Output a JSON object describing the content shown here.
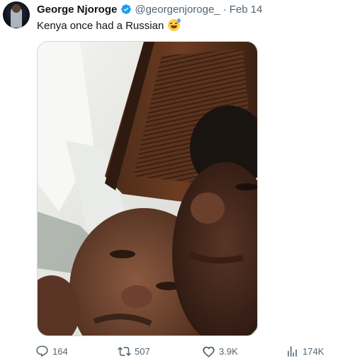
{
  "tweet": {
    "author_name": "George Njoroge",
    "author_handle": "@georgenjoroge_",
    "separator": "·",
    "date": "Feb 14",
    "text": "Kenya once had a Russian",
    "emoji": "grinning-face-with-sweat",
    "verified": true
  },
  "metrics": {
    "replies": "164",
    "reposts": "507",
    "likes": "3.9K",
    "views": "174K"
  },
  "colors": {
    "text": "#0f1419",
    "secondary": "#536471",
    "verified_blue": "#1d9bf0",
    "border": "#cfd9de"
  }
}
